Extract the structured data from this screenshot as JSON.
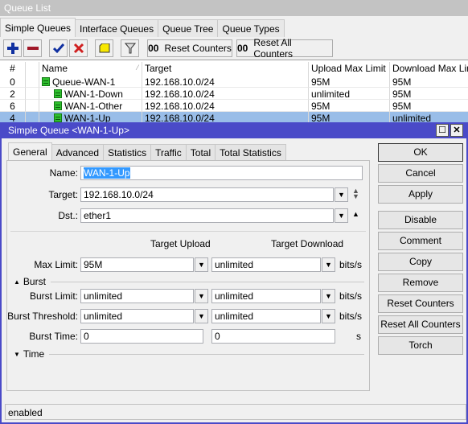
{
  "window": {
    "title": "Queue List"
  },
  "tabs": [
    "Simple Queues",
    "Interface Queues",
    "Queue Tree",
    "Queue Types"
  ],
  "toolbar": {
    "reset_counters": "Reset Counters",
    "reset_all_counters": "Reset All Counters",
    "counter_glyph": "00"
  },
  "table": {
    "headers": [
      "#",
      "",
      "Name",
      "Target",
      "Upload Max Limit",
      "Download Max Limit"
    ],
    "rows": [
      {
        "num": "0",
        "name": "Queue-WAN-1",
        "target": "192.168.10.0/24",
        "upload": "95M",
        "download": "95M",
        "level": 0,
        "selected": false
      },
      {
        "num": "2",
        "name": "WAN-1-Down",
        "target": "192.168.10.0/24",
        "upload": "unlimited",
        "download": "95M",
        "level": 1,
        "selected": false
      },
      {
        "num": "6",
        "name": "WAN-1-Other",
        "target": "192.168.10.0/24",
        "upload": "95M",
        "download": "95M",
        "level": 1,
        "selected": false
      },
      {
        "num": "4",
        "name": "WAN-1-Up",
        "target": "192.168.10.0/24",
        "upload": "95M",
        "download": "unlimited",
        "level": 1,
        "selected": true
      }
    ]
  },
  "dialog": {
    "title": "Simple Queue <WAN-1-Up>",
    "tabs": [
      "General",
      "Advanced",
      "Statistics",
      "Traffic",
      "Total",
      "Total Statistics"
    ],
    "fields": {
      "name_label": "Name:",
      "name_value": "WAN-1-Up",
      "target_label": "Target:",
      "target_value": "192.168.10.0/24",
      "dst_label": "Dst.:",
      "dst_value": "ether1",
      "col_upload": "Target Upload",
      "col_download": "Target Download",
      "max_limit_label": "Max Limit:",
      "max_limit_up": "95M",
      "max_limit_down": "unlimited",
      "burst_section": "Burst",
      "burst_limit_label": "Burst Limit:",
      "burst_limit_up": "unlimited",
      "burst_limit_down": "unlimited",
      "burst_threshold_label": "Burst Threshold:",
      "burst_threshold_up": "unlimited",
      "burst_threshold_down": "unlimited",
      "burst_time_label": "Burst Time:",
      "burst_time_up": "0",
      "burst_time_down": "0",
      "time_section": "Time",
      "unit_bits": "bits/s",
      "unit_s": "s"
    },
    "buttons": [
      "OK",
      "Cancel",
      "Apply",
      "Disable",
      "Comment",
      "Copy",
      "Remove",
      "Reset Counters",
      "Reset All Counters",
      "Torch"
    ],
    "status": "enabled"
  }
}
